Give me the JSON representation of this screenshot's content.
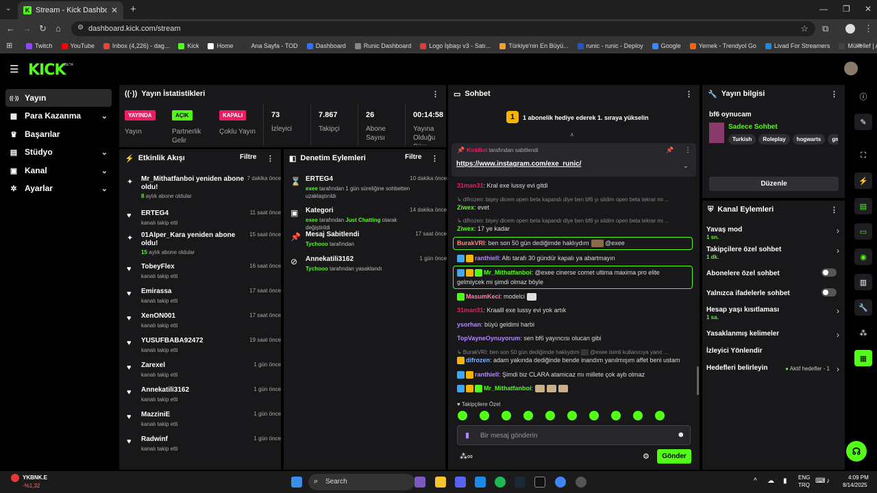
{
  "browser": {
    "tab_title": "Stream - Kick Dashboard",
    "url": "dashboard.kick.com/stream",
    "bookmarks": [
      {
        "label": "Twitch",
        "color": "#9146ff"
      },
      {
        "label": "YouTube",
        "color": "#ff0000"
      },
      {
        "label": "Inbox (4,226) - dag...",
        "color": "#ea4335"
      },
      {
        "label": "Kick",
        "color": "#53fc18"
      },
      {
        "label": "Home",
        "color": "#ffffff"
      },
      {
        "label": "Ana Sayfa - TOD",
        "color": "#333333"
      },
      {
        "label": "Dashboard",
        "color": "#3a6df0"
      },
      {
        "label": "Runic Dashboard",
        "color": "#888888"
      },
      {
        "label": "Logo İşbaşı v3 - Satı...",
        "color": "#e53935"
      },
      {
        "label": "Türkiye'nin En Büyü...",
        "color": "#f4a21f"
      },
      {
        "label": "runic - runic - Deploy",
        "color": "#2255cc"
      },
      {
        "label": "Google",
        "color": "#4285f4"
      },
      {
        "label": "Yemek - Trendyol Go",
        "color": "#ff6000"
      },
      {
        "label": "Livad For Streamers",
        "color": "#1e88e5"
      },
      {
        "label": "Mükellef | Anasayfa...",
        "color": "#444444"
      }
    ]
  },
  "brand": {
    "logo": "KICK",
    "beta": "BETA",
    "accent": "#53fc18"
  },
  "sidebar": {
    "items": [
      {
        "label": "Yayın",
        "icon": "broadcast-icon",
        "glyph": "((·))"
      },
      {
        "label": "Para Kazanma",
        "icon": "money-icon",
        "glyph": "▦"
      },
      {
        "label": "Başarılar",
        "icon": "trophy-icon",
        "glyph": "♛"
      },
      {
        "label": "Stüdyo",
        "icon": "studio-icon",
        "glyph": "▤"
      },
      {
        "label": "Kanal",
        "icon": "channel-icon",
        "glyph": "▣"
      },
      {
        "label": "Ayarlar",
        "icon": "settings-icon",
        "glyph": "✲"
      }
    ]
  },
  "stats": {
    "title": "Yayın İstatistikleri",
    "items": [
      {
        "badge": "YAYINDA",
        "badge_color": "#e91e63",
        "label": "Yayın"
      },
      {
        "badge": "AÇIK",
        "badge_color": "#53fc18",
        "label": "Partnerlik Gelir"
      },
      {
        "badge": "KAPALI",
        "badge_color": "#e91e63",
        "label": "Çoklu Yayın"
      },
      {
        "value": "73",
        "label": "İzleyici"
      },
      {
        "value": "7.867",
        "label": "Takipçi"
      },
      {
        "value": "26",
        "label": "Abone Sayısı"
      },
      {
        "value": "00:14:58",
        "label": "Yayına Olduğu Süre"
      }
    ]
  },
  "activity": {
    "title": "Etkinlik Akışı",
    "filter": "Filtre",
    "items": [
      {
        "name": "Mr_Mithatfanboi yeniden abone oldu!",
        "sub_num": "8",
        "sub": " aylık abone oldular",
        "time": "7 dakika önce",
        "icon": "sparkle-icon",
        "glyph": "✦"
      },
      {
        "name": "ERTEG4",
        "sub": "kanalı takip etti",
        "time": "11 saat önce",
        "icon": "heart-icon",
        "glyph": "♥"
      },
      {
        "name": "01Alper_Kara yeniden abone oldu!",
        "sub_num": "15",
        "sub": " aylık abone oldular",
        "time": "15 saat önce",
        "icon": "sparkle-icon",
        "glyph": "✦"
      },
      {
        "name": "TobeyFlex",
        "sub": "kanalı takip etti",
        "time": "16 saat önce",
        "icon": "heart-icon",
        "glyph": "♥"
      },
      {
        "name": "Emirassa",
        "sub": "kanalı takip etti",
        "time": "17 saat önce",
        "icon": "heart-icon",
        "glyph": "♥"
      },
      {
        "name": "XenON001",
        "sub": "kanalı takip etti",
        "time": "17 saat önce",
        "icon": "heart-icon",
        "glyph": "♥"
      },
      {
        "name": "YUSUFBABA92472",
        "sub": "kanalı takip etti",
        "time": "19 saat önce",
        "icon": "heart-icon",
        "glyph": "♥"
      },
      {
        "name": "Zarexel",
        "sub": "kanalı takip etti",
        "time": "1 gün önce",
        "icon": "heart-icon",
        "glyph": "♥"
      },
      {
        "name": "Annekatili3162",
        "sub": "kanalı takip etti",
        "time": "1 gün önce",
        "icon": "heart-icon",
        "glyph": "♥"
      },
      {
        "name": "MazziniE",
        "sub": "kanalı takip etti",
        "time": "1 gün önce",
        "icon": "heart-icon",
        "glyph": "♥"
      },
      {
        "name": "Radwinf",
        "sub": "kanalı takip etti",
        "time": "1 gün önce",
        "icon": "heart-icon",
        "glyph": "♥"
      }
    ]
  },
  "moderation": {
    "title": "Denetim Eylemleri",
    "filter": "Filtre",
    "items": [
      {
        "name": "ERTEG4",
        "actor": "exee",
        "text": " tarafından 1 gün süreliğine sohbetten uzaklaştırıldı",
        "time": "10 dakika önce",
        "icon": "hourglass-icon",
        "glyph": "⌛"
      },
      {
        "name": "Kategori",
        "actor": "exee",
        "text": " tarafından ",
        "extra": "Just Chatting",
        "text2": " olarak değiştirildi",
        "time": "14 dakika önce",
        "icon": "category-icon",
        "glyph": "▣"
      },
      {
        "name": "Mesaj Sabitlendi",
        "actor": "Tychooo",
        "text": " tarafından",
        "time": "17 saat önce",
        "icon": "pin-icon",
        "glyph": "📌"
      },
      {
        "name": "Annekatili3162",
        "actor": "Tychooo",
        "text": " tarafından yasaklandı",
        "time": "1 gün önce",
        "icon": "ban-icon",
        "glyph": "⊘"
      }
    ]
  },
  "chat": {
    "title": "Sohbet",
    "goal_num": "1",
    "goal_text": "1 abonelik hediye ederek 1. sıraya yükselin",
    "pinned_by": "KickBot",
    "pinned_suffix": " tarafından sabitlendi",
    "pinned_link": "https://www.instagram.com/exe_runic/",
    "followers_only_label": "Takipçilere Özel",
    "input_placeholder": "Bir mesaj gönderin",
    "send_label": "Gönder",
    "messages": [
      {
        "type": "msg",
        "user": "31man31",
        "color": "#e91e63",
        "text": ": Kral exe lussy evi gitdi"
      },
      {
        "type": "reply",
        "text": "↳ difrozen: bişey dicem open beta kapandı diye ben bf6 yı sildim open beta tekrar mı ..."
      },
      {
        "type": "msg",
        "user": "Ziwex",
        "color": "#53fc18",
        "text": ": evet"
      },
      {
        "type": "reply",
        "text": "↳ difrozen: bişey dicem open beta kapandı diye ben bf6 yı sildim open beta tekrar mı ..."
      },
      {
        "type": "msg",
        "user": "Ziwex",
        "color": "#53fc18",
        "text": ": 17 ye kadar"
      },
      {
        "type": "msg",
        "user": "BurakVRI",
        "color": "#ff8a80",
        "text": ": ben son 50 gün dediğimde haklıydım",
        "tail": " @exee"
      },
      {
        "type": "msg",
        "user": "ranthiell",
        "color": "#b388ff",
        "text": ": Altı tarafı 30 gündür kapalı ya abartmayın"
      },
      {
        "type": "msg",
        "user": "Mr_Mithatfanboi",
        "color": "#53fc18",
        "text": ": @exee cinerse comet ultima maxima pro elite",
        "text2": "gelmiycek mi şimdi olmaz böyle"
      },
      {
        "type": "msg",
        "user": "MasumKeci",
        "color": "#ff80ab",
        "text": ": modelci"
      },
      {
        "type": "msg",
        "user": "31man31",
        "color": "#e91e63",
        "text": ": Kraalll exe lussy evi yok artık"
      },
      {
        "type": "msg",
        "user": "ysorhan",
        "color": "#b388ff",
        "text": ": büyü geldimi harbi"
      },
      {
        "type": "msg",
        "user": "TopVayneOynuyorum",
        "color": "#b388ff",
        "text": ": sen bf6 yayıncısı olucan gibi"
      },
      {
        "type": "reply",
        "text": "↳ BurakVRI: ben son 50 gün dediğimde haklıydım ▒▒ @exee isimli kullanıcıya yanıt ..."
      },
      {
        "type": "msg",
        "user": "difrozen",
        "color": "#82b1ff",
        "text": ": adam yakında dediğinde bende inandım yanılmışım affet beni ustam"
      },
      {
        "type": "msg",
        "user": "ranthiell",
        "color": "#b388ff",
        "text": ": Şimdi biz CLARA atamicaz mı millete çok ayb olmaz"
      },
      {
        "type": "msg",
        "user": "Mr_Mithatfanboi",
        "color": "#53fc18",
        "text": ":"
      }
    ]
  },
  "stream_info": {
    "title": "Yayın bilgisi",
    "game": "bf6 oynucam",
    "category": "Sadece Sohbet",
    "tags": [
      "Turkish",
      "Roleplay",
      "hogwarts",
      "gm"
    ],
    "edit_label": "Düzenle"
  },
  "channel_actions": {
    "title": "Kanal Eylemleri",
    "items": [
      {
        "name": "Yavaş mod",
        "sub": "1 sn.",
        "control": "chevron"
      },
      {
        "name": "Takipçilere özel sohbet",
        "sub": "1 dk.",
        "control": "chevron"
      },
      {
        "name": "Abonelere özel sohbet",
        "control": "toggle"
      },
      {
        "name": "Yalnızca ifadelerle sohbet",
        "control": "toggle"
      },
      {
        "name": "Hesap yaşı kısıtlaması",
        "sub": "1 sa.",
        "control": "chevron"
      },
      {
        "name": "Yasaklanmış kelimeler",
        "control": "chevron"
      },
      {
        "name": "İzleyici Yönlendir",
        "control": "none"
      },
      {
        "name": "Hedefleri belirleyin",
        "control": "chevron",
        "status": "Aktif hedefler - 1"
      }
    ]
  },
  "taskbar": {
    "stock_name": "YKBNK.E",
    "stock_change": "-%1,32",
    "search": "Search",
    "lang1": "ENG",
    "lang2": "TRQ",
    "time": "4:09 PM",
    "date": "8/14/2025"
  }
}
